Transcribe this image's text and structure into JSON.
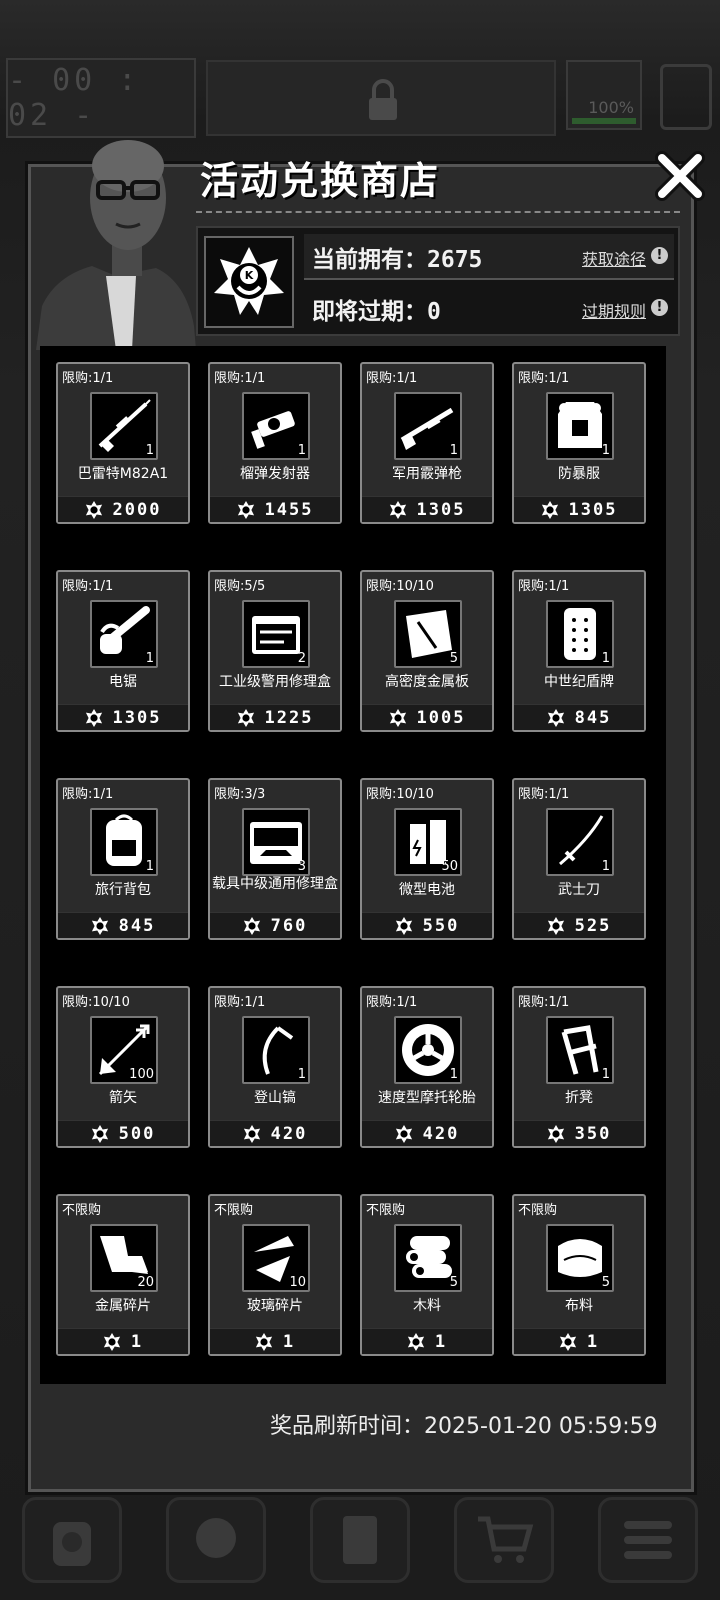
{
  "hud": {
    "timer": "- 00 : 02 -",
    "battery": "100%"
  },
  "shop": {
    "title": "活动兑换商店",
    "owned_label": "当前拥有：",
    "owned_value": "2675",
    "obtain_link": "获取途径",
    "expire_label": "即将过期：",
    "expire_value": "0",
    "expire_link": "过期规则",
    "refresh_label": "奖品刷新时间：",
    "refresh_time": "2025-01-20 05:59:59"
  },
  "items": [
    {
      "limit": "限购:1/1",
      "name": "巴雷特M82A1",
      "qty": "1",
      "price": "2000",
      "icon": "sniper-rifle-icon"
    },
    {
      "limit": "限购:1/1",
      "name": "榴弹发射器",
      "qty": "1",
      "price": "1455",
      "icon": "grenade-launcher-icon"
    },
    {
      "limit": "限购:1/1",
      "name": "军用霰弹枪",
      "qty": "1",
      "price": "1305",
      "icon": "shotgun-icon"
    },
    {
      "limit": "限购:1/1",
      "name": "防暴服",
      "qty": "1",
      "price": "1305",
      "icon": "riot-armor-icon"
    },
    {
      "limit": "限购:1/1",
      "name": "电锯",
      "qty": "1",
      "price": "1305",
      "icon": "chainsaw-icon"
    },
    {
      "limit": "限购:5/5",
      "name": "工业级警用修理盒",
      "qty": "2",
      "price": "1225",
      "icon": "repair-kit-icon"
    },
    {
      "limit": "限购:10/10",
      "name": "高密度金属板",
      "qty": "5",
      "price": "1005",
      "icon": "metal-plate-icon"
    },
    {
      "limit": "限购:1/1",
      "name": "中世纪盾牌",
      "qty": "1",
      "price": "845",
      "icon": "shield-icon"
    },
    {
      "limit": "限购:1/1",
      "name": "旅行背包",
      "qty": "1",
      "price": "845",
      "icon": "backpack-icon"
    },
    {
      "limit": "限购:3/3",
      "name": "载具中级通用修理盒",
      "qty": "3",
      "price": "760",
      "icon": "vehicle-repair-kit-icon"
    },
    {
      "limit": "限购:10/10",
      "name": "微型电池",
      "qty": "50",
      "price": "550",
      "icon": "battery-icon"
    },
    {
      "limit": "限购:1/1",
      "name": "武士刀",
      "qty": "1",
      "price": "525",
      "icon": "katana-icon"
    },
    {
      "limit": "限购:10/10",
      "name": "箭矢",
      "qty": "100",
      "price": "500",
      "icon": "arrow-icon"
    },
    {
      "limit": "限购:1/1",
      "name": "登山镐",
      "qty": "1",
      "price": "420",
      "icon": "ice-axe-icon"
    },
    {
      "limit": "限购:1/1",
      "name": "速度型摩托轮胎",
      "qty": "1",
      "price": "420",
      "icon": "tire-icon"
    },
    {
      "limit": "限购:1/1",
      "name": "折凳",
      "qty": "1",
      "price": "350",
      "icon": "folding-chair-icon"
    },
    {
      "limit": "不限购",
      "name": "金属碎片",
      "qty": "20",
      "price": "1",
      "icon": "metal-scrap-icon"
    },
    {
      "limit": "不限购",
      "name": "玻璃碎片",
      "qty": "10",
      "price": "1",
      "icon": "glass-shard-icon"
    },
    {
      "limit": "不限购",
      "name": "木料",
      "qty": "5",
      "price": "1",
      "icon": "wood-icon"
    },
    {
      "limit": "不限购",
      "name": "布料",
      "qty": "5",
      "price": "1",
      "icon": "cloth-icon"
    }
  ]
}
